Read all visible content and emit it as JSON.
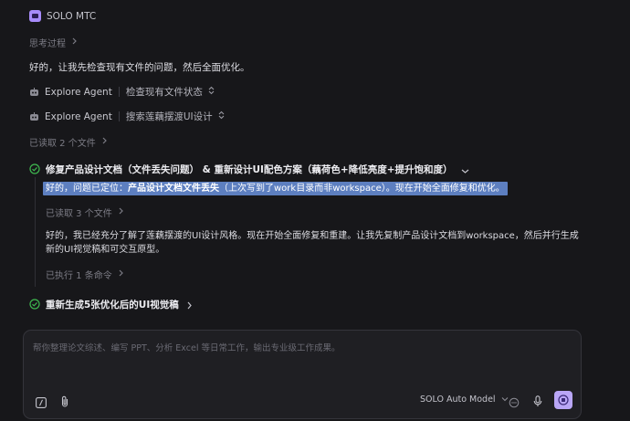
{
  "header": {
    "app_name": "SOLO MTC",
    "thinking_label": "思考过程"
  },
  "assistant": {
    "intro": "好的，让我先检查现有文件的问题，然后全面优化。",
    "agents": [
      {
        "name": "Explore Agent",
        "status": "检查现有文件状态"
      },
      {
        "name": "Explore Agent",
        "status": "搜索莲藕摆渡UI设计"
      }
    ],
    "files_read_1": "已读取 2 个文件"
  },
  "task1": {
    "title": "修复产品设计文档（文件丢失问题） & 重新设计UI配色方案（藕荷色+降低亮度+提升饱和度）",
    "highlight_prefix": "好的，问题已定位：",
    "highlight_bold": "产品设计文档文件丢失",
    "highlight_suffix": "（上次写到了work目录而非workspace）。现在开始全面修复和优化。",
    "files_read": "已读取 3 个文件",
    "analysis": "好的，我已经充分了解了莲藕摆渡的UI设计风格。现在开始全面修复和重建。让我先复制产品设计文档到workspace，然后并行生成新的UI视觉稿和可交互原型。",
    "commands_run": "已执行 1 条命令"
  },
  "task2": {
    "title": "重新生成5张优化后的UI视觉稿"
  },
  "composer": {
    "placeholder": "帮你整理论文综述、编写 PPT、分析 Excel 等日常工作，输出专业级工作成果。",
    "model_label": "SOLO Auto Model"
  },
  "colors": {
    "accent": "#a78bfa",
    "success": "#3fb950",
    "highlight": "#5d7fc0"
  }
}
